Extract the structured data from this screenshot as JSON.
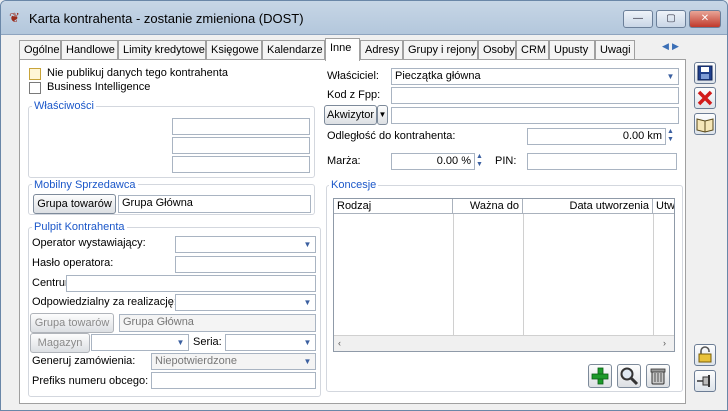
{
  "window": {
    "title": "Karta kontrahenta - zostanie zmieniona (DOST)",
    "controls": [
      "—",
      "▢",
      "✕"
    ]
  },
  "tabs": [
    {
      "label": "Ogólne"
    },
    {
      "label": "Handlowe"
    },
    {
      "label": "Limity kredytowe"
    },
    {
      "label": "Księgowe"
    },
    {
      "label": "Kalendarze"
    },
    {
      "label": "Inne"
    },
    {
      "label": "Adresy"
    },
    {
      "label": "Grupy i rejony"
    },
    {
      "label": "Osoby"
    },
    {
      "label": "CRM"
    },
    {
      "label": "Upusty"
    },
    {
      "label": "Uwagi"
    }
  ],
  "active_tab": "Inne",
  "tab_nav": {
    "left": "◀",
    "right": "▶"
  },
  "options": {
    "nie_publikuj": "Nie publikuj danych tego kontrahenta",
    "business_intelligence": "Business Intelligence"
  },
  "wlasciwosci": {
    "title": "Właściwości"
  },
  "mobilny": {
    "title": "Mobilny Sprzedawca",
    "group_button": "Grupa towarów",
    "group_value": "Grupa Główna"
  },
  "pulpit": {
    "title": "Pulpit Kontrahenta",
    "operator_label": "Operator wystawiający:",
    "haslo_label": "Hasło operatora:",
    "centrum_label": "Centrum:",
    "odpowiedzialny_label": "Odpowiedzialny za realizację:",
    "group_button": "Grupa towarów",
    "group_value": "Grupa Główna",
    "magazyn_button": "Magazyn",
    "seria_label": "Seria:",
    "generuj_label": "Generuj zamówienia:",
    "generuj_value": "Niepotwierdzone",
    "prefiks_label": "Prefiks numeru obcego:"
  },
  "right": {
    "wlasciciel_label": "Właściciel:",
    "wlasciciel_value": "Pieczątka główna",
    "kod_label": "Kod z Fpp:",
    "akwizytor_button": "Akwizytor",
    "odleglosc_label": "Odległość do kontrahenta:",
    "odleglosc_value": "0.00 km",
    "marza_label": "Marża:",
    "marza_value": "0.00 %",
    "pin_label": "PIN:"
  },
  "koncesje": {
    "title": "Koncesje",
    "columns": [
      "Rodzaj",
      "Ważna do",
      "Data utworzenia",
      "Utw"
    ]
  },
  "icons": {
    "save": "save-icon",
    "delete": "delete-icon",
    "book": "book-icon",
    "add": "add-icon",
    "search": "magnifier-icon",
    "trash": "trash-icon",
    "lock": "lock-icon",
    "pin": "pin-icon"
  }
}
